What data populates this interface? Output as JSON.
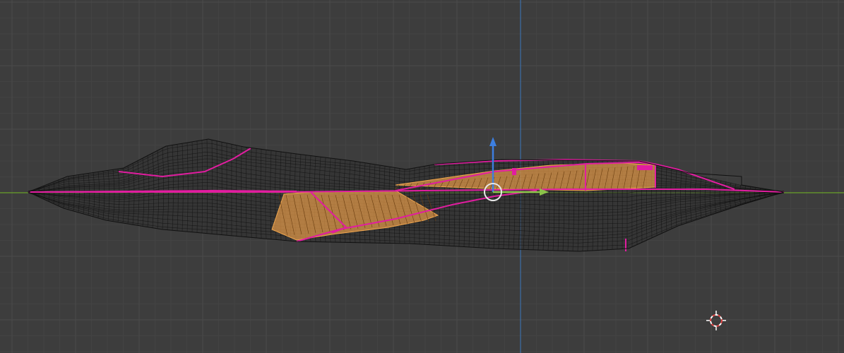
{
  "viewport": {
    "background_color": "#3d3d3d",
    "grid_minor_color": "#434343",
    "grid_major_color": "#4a4a4a",
    "x_axis_color": "#6aa32a",
    "z_axis_color": "#3d6fa8"
  },
  "model": {
    "wire_color": "#101010",
    "edge_color": "#e11da0",
    "selected_face_color": "#e39a4a",
    "selected_edge_color": "#f0a64e"
  },
  "gizmo": {
    "x_arrow_color": "#8bc34a",
    "z_arrow_color": "#3d7fe0",
    "center_ring_color": "#e8e8e8",
    "icon": "move-gizmo-icon"
  },
  "cursor": {
    "icon": "3d-cursor-icon",
    "primary_color": "#e04545",
    "secondary_color": "#ffffff"
  }
}
